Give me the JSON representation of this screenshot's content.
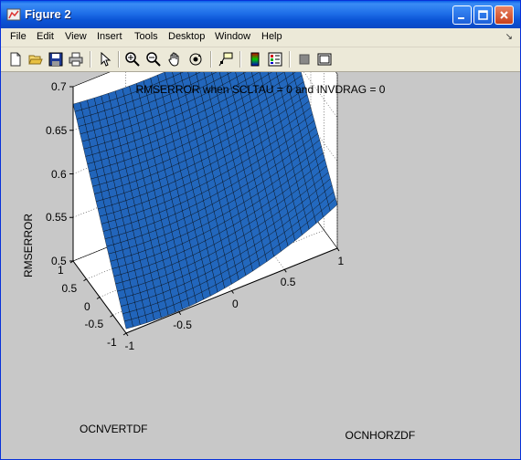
{
  "window": {
    "title": "Figure 2",
    "minimize": "minimize",
    "maximize": "maximize",
    "close": "close"
  },
  "menu": [
    "File",
    "Edit",
    "View",
    "Insert",
    "Tools",
    "Desktop",
    "Window",
    "Help"
  ],
  "toolbar": {
    "icons": [
      "new-figure-icon",
      "open-file-icon",
      "save-icon",
      "print-icon",
      "select-arrow-icon",
      "zoom-in-icon",
      "zoom-out-icon",
      "pan-hand-icon",
      "rotate-3d-icon",
      "data-cursor-icon",
      "colorbar-icon",
      "legend-icon",
      "hide-plot-tools-icon",
      "show-plot-tools-icon"
    ]
  },
  "chart_data": {
    "type": "surface",
    "title": "RMSERROR when SCLTAU = 0 and INVDRAG = 0",
    "xlabel": "OCNHORZDF",
    "ylabel": "OCNVERTDF",
    "zlabel": "RMSERROR",
    "xlim": [
      -1,
      1
    ],
    "ylim": [
      -1,
      1
    ],
    "zlim": [
      0.5,
      0.7
    ],
    "xticks": [
      "-1",
      "-0.5",
      "0",
      "0.5",
      "1"
    ],
    "yticks": [
      "-1",
      "-0.5",
      "0",
      "0.5",
      "1"
    ],
    "zticks": [
      "0.5",
      "0.55",
      "0.6",
      "0.65",
      "0.7"
    ],
    "corners": [
      {
        "x": -1,
        "y": 1,
        "z": 0.68
      },
      {
        "x": 1,
        "y": 1,
        "z": 0.69
      },
      {
        "x": 1,
        "y": -1,
        "z": 0.55
      },
      {
        "x": -1,
        "y": -1,
        "z": 0.505
      }
    ],
    "grid": true,
    "colors": {
      "surface": "#1e6fe0",
      "surface_dark": "#001a66",
      "surface_light": "#3fa0ff",
      "mesh": "#000000",
      "background": "#c8c8c8",
      "axes": "#ffffff"
    }
  }
}
